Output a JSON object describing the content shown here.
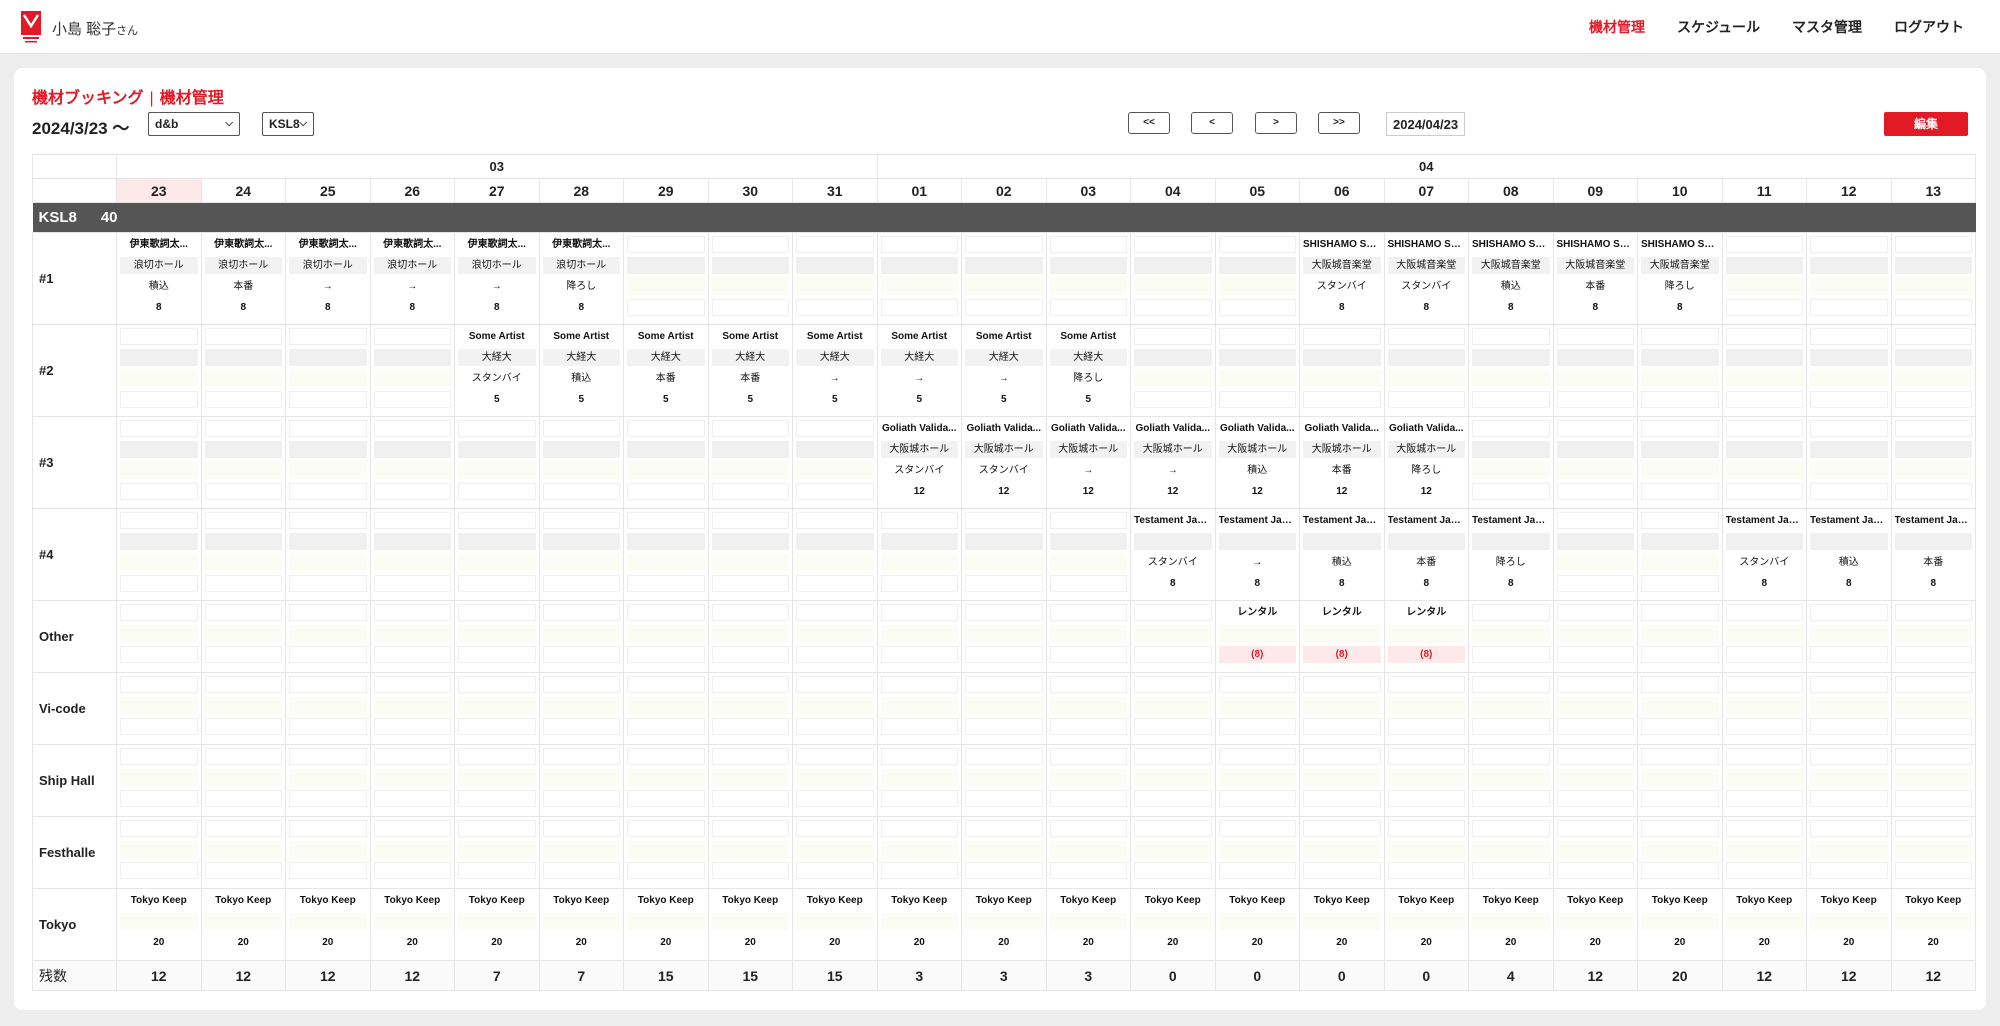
{
  "header": {
    "user_name": "小島 聡子",
    "user_suffix": "さん",
    "nav": [
      {
        "label": "機材管理",
        "active": true
      },
      {
        "label": "スケジュール",
        "active": false
      },
      {
        "label": "マスタ管理",
        "active": false
      },
      {
        "label": "ログアウト",
        "active": false
      }
    ],
    "accent_color": "#e11a25"
  },
  "page": {
    "breadcrumb_1": "機材ブッキング",
    "breadcrumb_sep": "|",
    "breadcrumb_2": "機材管理",
    "date_range": "2024/3/23 〜",
    "brand_select": "d&b",
    "model_select": "KSL8",
    "nav_buttons": [
      "<<",
      "<",
      ">",
      ">>"
    ],
    "jump_date": "2024/04/23",
    "edit_label": "編集"
  },
  "grid": {
    "months": [
      {
        "label": "03",
        "span": 9
      },
      {
        "label": "04",
        "span": 13
      }
    ],
    "days": [
      "23",
      "24",
      "25",
      "26",
      "27",
      "28",
      "29",
      "30",
      "31",
      "01",
      "02",
      "03",
      "04",
      "05",
      "06",
      "07",
      "08",
      "09",
      "10",
      "11",
      "12",
      "13"
    ],
    "today_index": 0,
    "section": {
      "name": "KSL8",
      "count": "40"
    },
    "rows": [
      {
        "label": "#1",
        "cells": [
          [
            "伊東歌詞太...",
            "浪切ホール",
            "積込",
            "8"
          ],
          [
            "伊東歌詞太...",
            "浪切ホール",
            "本番",
            "8"
          ],
          [
            "伊東歌詞太...",
            "浪切ホール",
            "→",
            "8"
          ],
          [
            "伊東歌詞太...",
            "浪切ホール",
            "→",
            "8"
          ],
          [
            "伊東歌詞太...",
            "浪切ホール",
            "→",
            "8"
          ],
          [
            "伊東歌詞太...",
            "浪切ホール",
            "降ろし",
            "8"
          ],
          null,
          null,
          null,
          null,
          null,
          null,
          null,
          null,
          [
            "SHISHAMO SH...",
            "大阪城音楽堂",
            "スタンバイ",
            "8"
          ],
          [
            "SHISHAMO SH...",
            "大阪城音楽堂",
            "スタンバイ",
            "8"
          ],
          [
            "SHISHAMO SH...",
            "大阪城音楽堂",
            "積込",
            "8"
          ],
          [
            "SHISHAMO SH...",
            "大阪城音楽堂",
            "本番",
            "8"
          ],
          [
            "SHISHAMO SH...",
            "大阪城音楽堂",
            "降ろし",
            "8"
          ],
          null,
          null,
          null
        ]
      },
      {
        "label": "#2",
        "cells": [
          null,
          null,
          null,
          null,
          [
            "Some Artist",
            "大経大",
            "スタンバイ",
            "5"
          ],
          [
            "Some Artist",
            "大経大",
            "積込",
            "5"
          ],
          [
            "Some Artist",
            "大経大",
            "本番",
            "5"
          ],
          [
            "Some Artist",
            "大経大",
            "本番",
            "5"
          ],
          [
            "Some Artist",
            "大経大",
            "→",
            "5"
          ],
          [
            "Some Artist",
            "大経大",
            "→",
            "5"
          ],
          [
            "Some Artist",
            "大経大",
            "→",
            "5"
          ],
          [
            "Some Artist",
            "大経大",
            "降ろし",
            "5"
          ],
          null,
          null,
          null,
          null,
          null,
          null,
          null,
          null,
          null,
          null
        ]
      },
      {
        "label": "#3",
        "cells": [
          null,
          null,
          null,
          null,
          null,
          null,
          null,
          null,
          null,
          [
            "Goliath Valida...",
            "大阪城ホール",
            "スタンバイ",
            "12"
          ],
          [
            "Goliath Valida...",
            "大阪城ホール",
            "スタンバイ",
            "12"
          ],
          [
            "Goliath Valida...",
            "大阪城ホール",
            "→",
            "12"
          ],
          [
            "Goliath Valida...",
            "大阪城ホール",
            "→",
            "12"
          ],
          [
            "Goliath Valida...",
            "大阪城ホール",
            "積込",
            "12"
          ],
          [
            "Goliath Valida...",
            "大阪城ホール",
            "本番",
            "12"
          ],
          [
            "Goliath Valida...",
            "大阪城ホール",
            "降ろし",
            "12"
          ],
          null,
          null,
          null,
          null,
          null,
          null
        ]
      },
      {
        "label": "#4",
        "cells": [
          null,
          null,
          null,
          null,
          null,
          null,
          null,
          null,
          null,
          null,
          null,
          null,
          [
            "Testament Jap...",
            "",
            "スタンバイ",
            "8"
          ],
          [
            "Testament Jap...",
            "",
            "→",
            "8"
          ],
          [
            "Testament Jap...",
            "",
            "積込",
            "8"
          ],
          [
            "Testament Jap...",
            "",
            "本番",
            "8"
          ],
          [
            "Testament Jap...",
            "",
            "降ろし",
            "8"
          ],
          null,
          null,
          [
            "Testament Jap...",
            "",
            "スタンバイ",
            "8"
          ],
          [
            "Testament Jap...",
            "",
            "積込",
            "8"
          ],
          [
            "Testament Jap...",
            "",
            "本番",
            "8"
          ]
        ]
      },
      {
        "label": "Other",
        "cells": [
          null,
          null,
          null,
          null,
          null,
          null,
          null,
          null,
          null,
          null,
          null,
          null,
          null,
          [
            "レンタル",
            "",
            "",
            "(8)"
          ],
          [
            "レンタル",
            "",
            "",
            "(8)"
          ],
          [
            "レンタル",
            "",
            "",
            "(8)"
          ],
          null,
          null,
          null,
          null,
          null,
          null
        ]
      },
      {
        "label": "Vi-code",
        "cells": []
      },
      {
        "label": "Ship Hall",
        "cells": []
      },
      {
        "label": "Festhalle",
        "cells": []
      },
      {
        "label": "Tokyo",
        "cells": "keep"
      }
    ],
    "tokyo_keep": {
      "title": "Tokyo Keep",
      "num": "20"
    },
    "remaining_label": "残数",
    "remaining": [
      "12",
      "12",
      "12",
      "12",
      "7",
      "7",
      "15",
      "15",
      "15",
      "3",
      "3",
      "3",
      "0",
      "0",
      "0",
      "0",
      "4",
      "12",
      "20",
      "12",
      "12",
      "12"
    ]
  }
}
